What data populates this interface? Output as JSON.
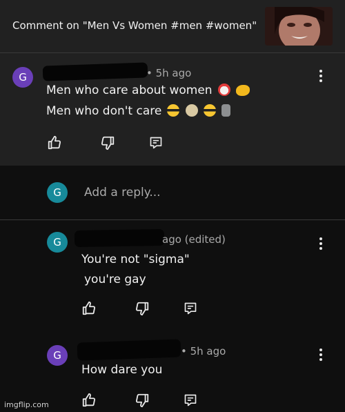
{
  "header": {
    "title": "Comment on \"Men Vs Women #men #women\""
  },
  "comment": {
    "avatar_letter": "G",
    "time": "• 5h ago",
    "line1": "Men who care about women",
    "line2": "Men who don't care"
  },
  "reply_box": {
    "avatar_letter": "G",
    "placeholder": "Add a reply..."
  },
  "replies": [
    {
      "avatar_letter": "G",
      "time": "ago (edited)",
      "line1": "You're not \"sigma\"",
      "line2": "you're gay"
    },
    {
      "avatar_letter": "G",
      "time": "• 5h ago",
      "line1": "How dare you"
    }
  ],
  "watermark": "imgflip.com",
  "icons": [
    "like-icon",
    "dislike-icon",
    "reply-icon",
    "more-options-icon"
  ],
  "colors": {
    "background": "#0f0f0f",
    "panel": "#212121",
    "avatar_purple": "#6a3fb8",
    "avatar_teal": "#178a9a"
  }
}
